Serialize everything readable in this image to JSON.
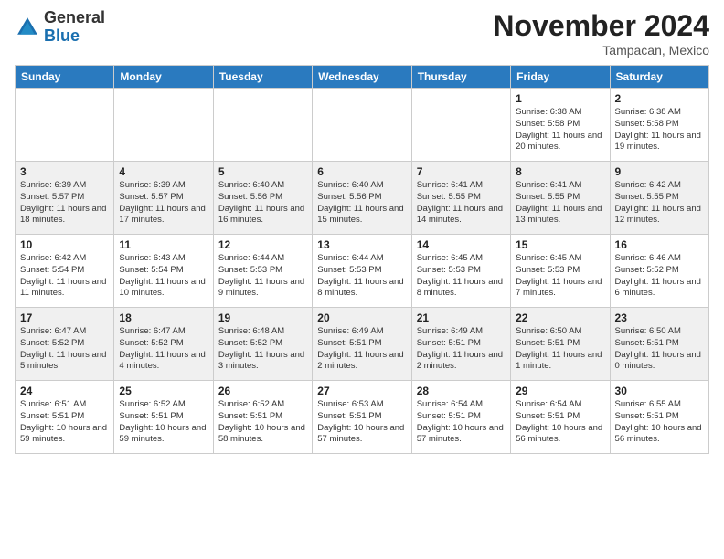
{
  "logo": {
    "general": "General",
    "blue": "Blue"
  },
  "header": {
    "month": "November 2024",
    "location": "Tampacan, Mexico"
  },
  "weekdays": [
    "Sunday",
    "Monday",
    "Tuesday",
    "Wednesday",
    "Thursday",
    "Friday",
    "Saturday"
  ],
  "weeks": [
    [
      {
        "day": "",
        "sunrise": "",
        "sunset": "",
        "daylight": ""
      },
      {
        "day": "",
        "sunrise": "",
        "sunset": "",
        "daylight": ""
      },
      {
        "day": "",
        "sunrise": "",
        "sunset": "",
        "daylight": ""
      },
      {
        "day": "",
        "sunrise": "",
        "sunset": "",
        "daylight": ""
      },
      {
        "day": "",
        "sunrise": "",
        "sunset": "",
        "daylight": ""
      },
      {
        "day": "1",
        "sunrise": "Sunrise: 6:38 AM",
        "sunset": "Sunset: 5:58 PM",
        "daylight": "Daylight: 11 hours and 20 minutes."
      },
      {
        "day": "2",
        "sunrise": "Sunrise: 6:38 AM",
        "sunset": "Sunset: 5:58 PM",
        "daylight": "Daylight: 11 hours and 19 minutes."
      }
    ],
    [
      {
        "day": "3",
        "sunrise": "Sunrise: 6:39 AM",
        "sunset": "Sunset: 5:57 PM",
        "daylight": "Daylight: 11 hours and 18 minutes."
      },
      {
        "day": "4",
        "sunrise": "Sunrise: 6:39 AM",
        "sunset": "Sunset: 5:57 PM",
        "daylight": "Daylight: 11 hours and 17 minutes."
      },
      {
        "day": "5",
        "sunrise": "Sunrise: 6:40 AM",
        "sunset": "Sunset: 5:56 PM",
        "daylight": "Daylight: 11 hours and 16 minutes."
      },
      {
        "day": "6",
        "sunrise": "Sunrise: 6:40 AM",
        "sunset": "Sunset: 5:56 PM",
        "daylight": "Daylight: 11 hours and 15 minutes."
      },
      {
        "day": "7",
        "sunrise": "Sunrise: 6:41 AM",
        "sunset": "Sunset: 5:55 PM",
        "daylight": "Daylight: 11 hours and 14 minutes."
      },
      {
        "day": "8",
        "sunrise": "Sunrise: 6:41 AM",
        "sunset": "Sunset: 5:55 PM",
        "daylight": "Daylight: 11 hours and 13 minutes."
      },
      {
        "day": "9",
        "sunrise": "Sunrise: 6:42 AM",
        "sunset": "Sunset: 5:55 PM",
        "daylight": "Daylight: 11 hours and 12 minutes."
      }
    ],
    [
      {
        "day": "10",
        "sunrise": "Sunrise: 6:42 AM",
        "sunset": "Sunset: 5:54 PM",
        "daylight": "Daylight: 11 hours and 11 minutes."
      },
      {
        "day": "11",
        "sunrise": "Sunrise: 6:43 AM",
        "sunset": "Sunset: 5:54 PM",
        "daylight": "Daylight: 11 hours and 10 minutes."
      },
      {
        "day": "12",
        "sunrise": "Sunrise: 6:44 AM",
        "sunset": "Sunset: 5:53 PM",
        "daylight": "Daylight: 11 hours and 9 minutes."
      },
      {
        "day": "13",
        "sunrise": "Sunrise: 6:44 AM",
        "sunset": "Sunset: 5:53 PM",
        "daylight": "Daylight: 11 hours and 8 minutes."
      },
      {
        "day": "14",
        "sunrise": "Sunrise: 6:45 AM",
        "sunset": "Sunset: 5:53 PM",
        "daylight": "Daylight: 11 hours and 8 minutes."
      },
      {
        "day": "15",
        "sunrise": "Sunrise: 6:45 AM",
        "sunset": "Sunset: 5:53 PM",
        "daylight": "Daylight: 11 hours and 7 minutes."
      },
      {
        "day": "16",
        "sunrise": "Sunrise: 6:46 AM",
        "sunset": "Sunset: 5:52 PM",
        "daylight": "Daylight: 11 hours and 6 minutes."
      }
    ],
    [
      {
        "day": "17",
        "sunrise": "Sunrise: 6:47 AM",
        "sunset": "Sunset: 5:52 PM",
        "daylight": "Daylight: 11 hours and 5 minutes."
      },
      {
        "day": "18",
        "sunrise": "Sunrise: 6:47 AM",
        "sunset": "Sunset: 5:52 PM",
        "daylight": "Daylight: 11 hours and 4 minutes."
      },
      {
        "day": "19",
        "sunrise": "Sunrise: 6:48 AM",
        "sunset": "Sunset: 5:52 PM",
        "daylight": "Daylight: 11 hours and 3 minutes."
      },
      {
        "day": "20",
        "sunrise": "Sunrise: 6:49 AM",
        "sunset": "Sunset: 5:51 PM",
        "daylight": "Daylight: 11 hours and 2 minutes."
      },
      {
        "day": "21",
        "sunrise": "Sunrise: 6:49 AM",
        "sunset": "Sunset: 5:51 PM",
        "daylight": "Daylight: 11 hours and 2 minutes."
      },
      {
        "day": "22",
        "sunrise": "Sunrise: 6:50 AM",
        "sunset": "Sunset: 5:51 PM",
        "daylight": "Daylight: 11 hours and 1 minute."
      },
      {
        "day": "23",
        "sunrise": "Sunrise: 6:50 AM",
        "sunset": "Sunset: 5:51 PM",
        "daylight": "Daylight: 11 hours and 0 minutes."
      }
    ],
    [
      {
        "day": "24",
        "sunrise": "Sunrise: 6:51 AM",
        "sunset": "Sunset: 5:51 PM",
        "daylight": "Daylight: 10 hours and 59 minutes."
      },
      {
        "day": "25",
        "sunrise": "Sunrise: 6:52 AM",
        "sunset": "Sunset: 5:51 PM",
        "daylight": "Daylight: 10 hours and 59 minutes."
      },
      {
        "day": "26",
        "sunrise": "Sunrise: 6:52 AM",
        "sunset": "Sunset: 5:51 PM",
        "daylight": "Daylight: 10 hours and 58 minutes."
      },
      {
        "day": "27",
        "sunrise": "Sunrise: 6:53 AM",
        "sunset": "Sunset: 5:51 PM",
        "daylight": "Daylight: 10 hours and 57 minutes."
      },
      {
        "day": "28",
        "sunrise": "Sunrise: 6:54 AM",
        "sunset": "Sunset: 5:51 PM",
        "daylight": "Daylight: 10 hours and 57 minutes."
      },
      {
        "day": "29",
        "sunrise": "Sunrise: 6:54 AM",
        "sunset": "Sunset: 5:51 PM",
        "daylight": "Daylight: 10 hours and 56 minutes."
      },
      {
        "day": "30",
        "sunrise": "Sunrise: 6:55 AM",
        "sunset": "Sunset: 5:51 PM",
        "daylight": "Daylight: 10 hours and 56 minutes."
      }
    ]
  ]
}
